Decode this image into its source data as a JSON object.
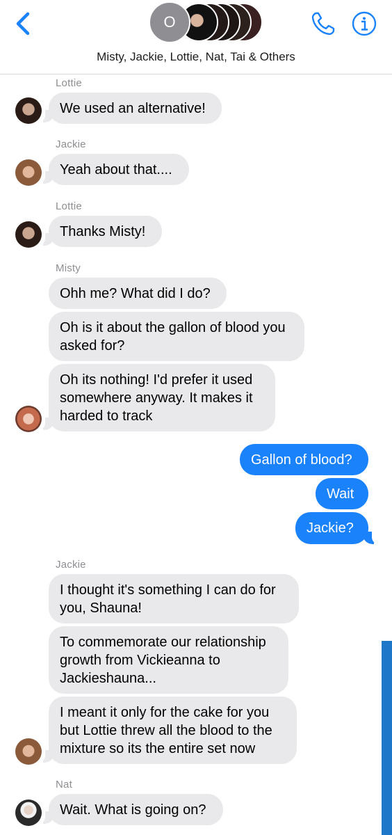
{
  "header": {
    "title": "Misty, Jackie, Lottie, Nat, Tai & Others",
    "avatar_initial": "O"
  },
  "messages": [
    {
      "sender": "Lottie",
      "text": "We used an alternative!"
    },
    {
      "sender": "Jackie",
      "text": "Yeah about that...."
    },
    {
      "sender": "Lottie",
      "text": "Thanks Misty!"
    },
    {
      "sender": "Misty",
      "text": "Ohh me? What did I do?"
    },
    {
      "text": "Oh is it about the gallon of blood you\nasked for?"
    },
    {
      "text": "Oh its nothing! I'd prefer it used\nsomewhere anyway. It makes it\nharded to track"
    },
    {
      "outgoing": true,
      "text": "Gallon of blood?"
    },
    {
      "outgoing": true,
      "text": "Wait"
    },
    {
      "outgoing": true,
      "text": "Jackie?"
    },
    {
      "sender": "Jackie",
      "text": "I thought it's something I can do for\nyou, Shauna!"
    },
    {
      "text": "To commemorate our relationship\ngrowth from Vickieanna to\nJackieshauna..."
    },
    {
      "text": "I meant it only for the cake for you\nbut Lottie threw all the blood to the\nmixture so its the entire set now"
    },
    {
      "sender": "Nat",
      "text": "Wait. What is going on?"
    }
  ],
  "colors": {
    "accent": "#1a82fb",
    "incoming_bubble": "#e9e9eb",
    "sender_label": "#8e8e93"
  },
  "icons": [
    "chevron-left-icon",
    "phone-icon",
    "info-icon"
  ]
}
